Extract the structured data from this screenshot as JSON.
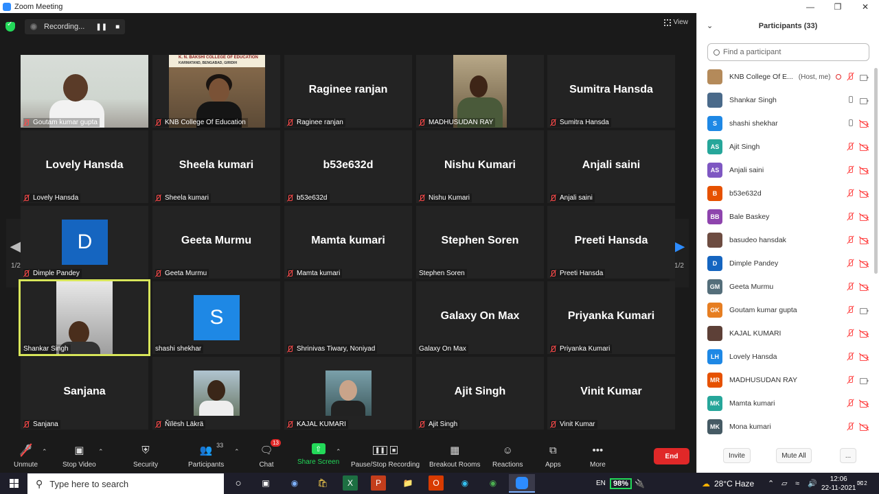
{
  "window": {
    "title": "Zoom Meeting"
  },
  "recording": {
    "status": "Recording..."
  },
  "view_label": "View",
  "page_indicator": "1/2",
  "tiles": [
    {
      "name": "Goutam kumar gupta",
      "type": "video",
      "muted": true
    },
    {
      "name": "KNB College Of Education",
      "type": "video",
      "muted": true,
      "banner": "K. N. BAKSHI COLLEGE OF EDUCATION",
      "subbanner": "KARMATAND, BENGABAD, GIRIDIH"
    },
    {
      "name": "Raginee ranjan",
      "type": "name",
      "muted": true
    },
    {
      "name": "MADHUSUDAN RAY",
      "type": "video",
      "muted": true
    },
    {
      "name": "Sumitra Hansda",
      "type": "name",
      "muted": true
    },
    {
      "name": "Lovely Hansda",
      "type": "name",
      "muted": true
    },
    {
      "name": "Sheela kumari",
      "type": "name",
      "muted": true
    },
    {
      "name": "b53e632d",
      "type": "name",
      "muted": true
    },
    {
      "name": "Nishu Kumari",
      "type": "name",
      "muted": true
    },
    {
      "name": "Anjali saini",
      "type": "name",
      "muted": true
    },
    {
      "name": "Dimple Pandey",
      "type": "avatar",
      "letter": "D",
      "color": "#1565c0",
      "muted": true
    },
    {
      "name": "Geeta Murmu",
      "type": "name",
      "muted": true
    },
    {
      "name": "Mamta kumari",
      "type": "name",
      "muted": true
    },
    {
      "name": "Stephen Soren",
      "type": "name",
      "muted": false
    },
    {
      "name": "Preeti Hansda",
      "type": "name",
      "muted": true
    },
    {
      "name": "Shankar Singh",
      "type": "video",
      "muted": false,
      "active": true
    },
    {
      "name": "shashi shekhar",
      "type": "avatar",
      "letter": "S",
      "color": "#1e88e5",
      "muted": false
    },
    {
      "name": "Shrinivas Tiwary, Noniyad",
      "type": "blank",
      "muted": true
    },
    {
      "name": "Galaxy On Max",
      "type": "name",
      "muted": false
    },
    {
      "name": "Priyanka Kumari",
      "type": "name",
      "muted": true
    },
    {
      "name": "Sanjana",
      "type": "name",
      "muted": true
    },
    {
      "name": "Ñïlësh Läkrä",
      "type": "photo",
      "muted": true
    },
    {
      "name": "KAJAL KUMARI",
      "type": "photo",
      "muted": true
    },
    {
      "name": "Ajit Singh",
      "type": "name",
      "muted": true
    },
    {
      "name": "Vinit Kumar",
      "type": "name",
      "muted": true
    }
  ],
  "toolbar": {
    "unmute": "Unmute",
    "stop_video": "Stop Video",
    "security": "Security",
    "participants": "Participants",
    "participants_count": "33",
    "chat": "Chat",
    "chat_badge": "13",
    "share_screen": "Share Screen",
    "pause_stop_recording": "Pause/Stop Recording",
    "breakout_rooms": "Breakout Rooms",
    "reactions": "Reactions",
    "apps": "Apps",
    "more": "More",
    "end": "End"
  },
  "panel": {
    "title": "Participants (33)",
    "search_placeholder": "Find a participant",
    "invite": "Invite",
    "mute_all": "Mute All",
    "more": "...",
    "participants": [
      {
        "name": "KNB College Of E...",
        "host": "(Host, me)",
        "initials": "",
        "color": "#b48a5a",
        "mic": "off",
        "cam": "on",
        "recording": true
      },
      {
        "name": "Shankar Singh",
        "initials": "",
        "color": "#4a6a8a",
        "mic": "on",
        "cam": "on"
      },
      {
        "name": "shashi shekhar",
        "initials": "S",
        "color": "#1e88e5",
        "mic": "on",
        "cam": "off"
      },
      {
        "name": "Ajit Singh",
        "initials": "AS",
        "color": "#26a69a",
        "mic": "off",
        "cam": "off"
      },
      {
        "name": "Anjali saini",
        "initials": "AS",
        "color": "#7e57c2",
        "mic": "off",
        "cam": "off"
      },
      {
        "name": "b53e632d",
        "initials": "B",
        "color": "#e65100",
        "mic": "off",
        "cam": "off"
      },
      {
        "name": "Bale Baskey",
        "initials": "BB",
        "color": "#8e44ad",
        "mic": "off",
        "cam": "off"
      },
      {
        "name": "basudeo hansdak",
        "initials": "",
        "color": "#6d4c41",
        "mic": "off",
        "cam": "off"
      },
      {
        "name": "Dimple Pandey",
        "initials": "D",
        "color": "#1565c0",
        "mic": "off",
        "cam": "off"
      },
      {
        "name": "Geeta Murmu",
        "initials": "GM",
        "color": "#546e7a",
        "mic": "off",
        "cam": "off"
      },
      {
        "name": "Goutam kumar gupta",
        "initials": "GK",
        "color": "#e67e22",
        "mic": "off",
        "cam": "on"
      },
      {
        "name": "KAJAL KUMARI",
        "initials": "",
        "color": "#5d4037",
        "mic": "off",
        "cam": "off"
      },
      {
        "name": "Lovely Hansda",
        "initials": "LH",
        "color": "#1e88e5",
        "mic": "off",
        "cam": "off"
      },
      {
        "name": "MADHUSUDAN RAY",
        "initials": "MR",
        "color": "#e65100",
        "mic": "off",
        "cam": "on"
      },
      {
        "name": "Mamta kumari",
        "initials": "MK",
        "color": "#26a69a",
        "mic": "off",
        "cam": "off"
      },
      {
        "name": "Mona kumari",
        "initials": "MK",
        "color": "#455a64",
        "mic": "off",
        "cam": "off"
      }
    ]
  },
  "taskbar": {
    "search_placeholder": "Type here to search",
    "battery": "98%",
    "weather": "28°C Haze",
    "language": "EN",
    "time": "12:06",
    "date": "22-11-2021",
    "notifications": "2"
  }
}
